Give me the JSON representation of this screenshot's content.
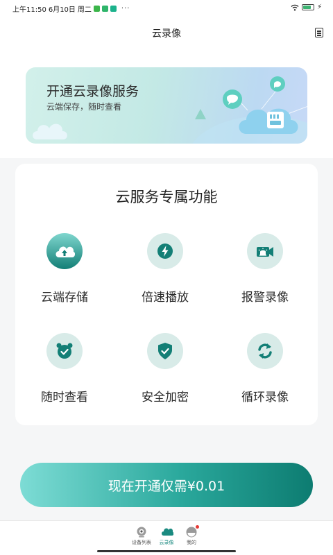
{
  "status_bar": {
    "time": "上午11:50",
    "date": "6月10日",
    "weekday": "周二",
    "more": "···",
    "app_icon_colors": [
      "#3bb54a",
      "#2fb56b",
      "#1cb28c"
    ],
    "battery_level": 0.8,
    "battery_color": "#3cb371"
  },
  "header": {
    "title": "云录像",
    "menu_icon": "document-list-icon"
  },
  "banner": {
    "title": "开通云录像服务",
    "subtitle": "云端保存，随时查看"
  },
  "features": {
    "title": "云服务专属功能",
    "accent": "#137f76",
    "items": [
      {
        "label": "云端存储",
        "icon": "cloud-upload-icon",
        "active": true
      },
      {
        "label": "倍速播放",
        "icon": "lightning-icon",
        "active": false
      },
      {
        "label": "报警录像",
        "icon": "alarm-siren-camera-icon",
        "active": false
      },
      {
        "label": "随时查看",
        "icon": "alarm-clock-icon",
        "active": false
      },
      {
        "label": "安全加密",
        "icon": "shield-check-icon",
        "active": false
      },
      {
        "label": "循环录像",
        "icon": "loop-arrows-icon",
        "active": false
      }
    ]
  },
  "cta": {
    "label": "现在开通仅需¥0.01"
  },
  "tabs": [
    {
      "label": "设备列表",
      "icon": "camera-icon",
      "active": false
    },
    {
      "label": "云录像",
      "icon": "cloud-icon",
      "active": true
    },
    {
      "label": "我的",
      "icon": "profile-icon",
      "active": false,
      "badge": true
    }
  ]
}
